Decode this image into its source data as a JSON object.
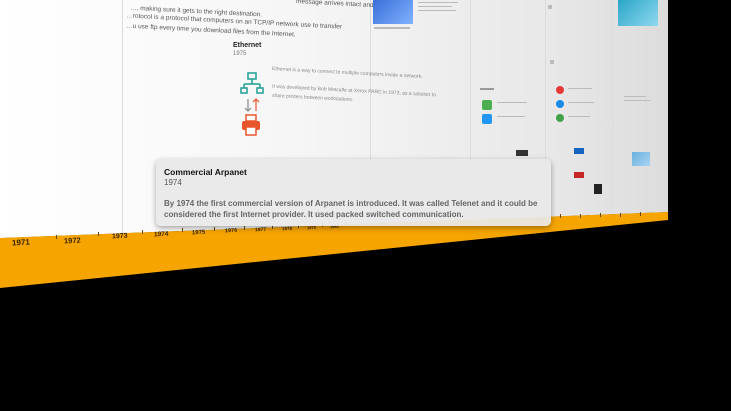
{
  "timeline": {
    "years": [
      "1971",
      "1972",
      "1973",
      "1974",
      "1975",
      "1976",
      "1977",
      "1978",
      "1979",
      "1980"
    ]
  },
  "panel_top": {
    "line1": "message arrives intact and",
    "line2": "…, making sure it gets to the right destination.",
    "line3": "…rotocol is a protocol that computers on an TCP/IP network use to transfer",
    "line4": "…u use ftp every time you download files from the Internet."
  },
  "ethernet": {
    "title": "Ethernet",
    "year": "1975",
    "text1": "Ethernet is a way to connect to multiple computers inside a network.",
    "text2": "It was developed by Bob Metcalfe at Xerox PARC in 1973, as a solution to",
    "text3": "share printers between workstations."
  },
  "tooltip": {
    "title": "Commercial Arpanet",
    "year": "1974",
    "body": "By 1974 the first commercial version of Arpanet is introduced. It was called Telenet and it could be considered the first Internet provider. It used packed switched communication."
  },
  "colors": {
    "band": "#f5a400",
    "ethernet_icon": "#2aa39a",
    "printer_icon": "#e8552c"
  }
}
